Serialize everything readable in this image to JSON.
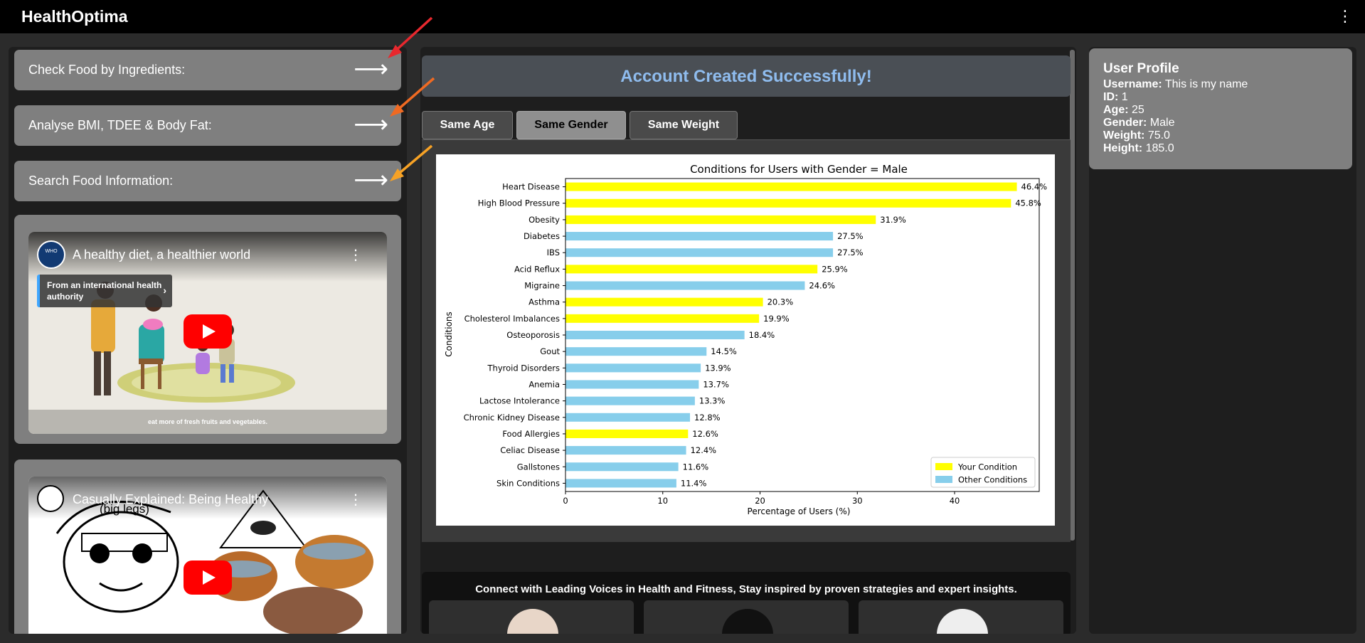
{
  "app": {
    "brand": "HealthOptima",
    "menu_icon": "kebab-menu-icon"
  },
  "sidebar": {
    "nav": [
      {
        "label": "Check Food by Ingredients:",
        "arrow": "⟶"
      },
      {
        "label": "Analyse BMI, TDEE & Body Fat:",
        "arrow": "⟶"
      },
      {
        "label": "Search Food Information:",
        "arrow": "⟶"
      }
    ],
    "videos": [
      {
        "title": "A healthy diet, a healthier world",
        "channel_badge": "From an international health authority",
        "caption": "eat more of fresh fruits and vegetables."
      },
      {
        "title": "Casually Explained: Being Healthy",
        "overlay_text": "(big legs)"
      }
    ]
  },
  "center": {
    "banner": "Account Created Successfully!",
    "tabs": [
      {
        "label": "Same Age",
        "active": false
      },
      {
        "label": "Same Gender",
        "active": true
      },
      {
        "label": "Same Weight",
        "active": false
      }
    ],
    "connect_title": "Connect with Leading Voices in Health and Fitness, Stay inspired by proven strategies and expert insights."
  },
  "profile": {
    "title": "User Profile",
    "fields": [
      {
        "key": "Username:",
        "value": "This is my name"
      },
      {
        "key": "ID:",
        "value": "1"
      },
      {
        "key": "Age:",
        "value": "25"
      },
      {
        "key": "Gender:",
        "value": "Male"
      },
      {
        "key": "Weight:",
        "value": "75.0"
      },
      {
        "key": "Height:",
        "value": "185.0"
      }
    ]
  },
  "colors": {
    "your_condition": "#ffff00",
    "other_conditions": "#87ceeb",
    "banner_text": "#8fbcee"
  },
  "chart_data": {
    "type": "bar",
    "orientation": "horizontal",
    "title": "Conditions for Users with Gender = Male",
    "xlabel": "Percentage of Users (%)",
    "ylabel": "Conditions",
    "xlim": [
      0,
      48.7
    ],
    "xticks": [
      0,
      10,
      20,
      30,
      40
    ],
    "legend": {
      "placement": "bottom-right",
      "entries": [
        "Your Condition",
        "Other Conditions"
      ]
    },
    "categories": [
      "Heart Disease",
      "High Blood Pressure",
      "Obesity",
      "Diabetes",
      "IBS",
      "Acid Reflux",
      "Migraine",
      "Asthma",
      "Cholesterol Imbalances",
      "Osteoporosis",
      "Gout",
      "Thyroid Disorders",
      "Anemia",
      "Lactose Intolerance",
      "Chronic Kidney Disease",
      "Food Allergies",
      "Celiac Disease",
      "Gallstones",
      "Skin Conditions"
    ],
    "values": [
      46.4,
      45.8,
      31.9,
      27.5,
      27.5,
      25.9,
      24.6,
      20.3,
      19.9,
      18.4,
      14.5,
      13.9,
      13.7,
      13.3,
      12.8,
      12.6,
      12.4,
      11.6,
      11.4
    ],
    "value_labels": [
      "46.4%",
      "45.8%",
      "31.9%",
      "27.5%",
      "27.5%",
      "25.9%",
      "24.6%",
      "20.3%",
      "19.9%",
      "18.4%",
      "14.5%",
      "13.9%",
      "13.7%",
      "13.3%",
      "12.8%",
      "12.6%",
      "12.4%",
      "11.6%",
      "11.4%"
    ],
    "is_your_condition": [
      true,
      true,
      true,
      false,
      false,
      true,
      false,
      true,
      true,
      false,
      false,
      false,
      false,
      false,
      false,
      true,
      false,
      false,
      false
    ]
  }
}
